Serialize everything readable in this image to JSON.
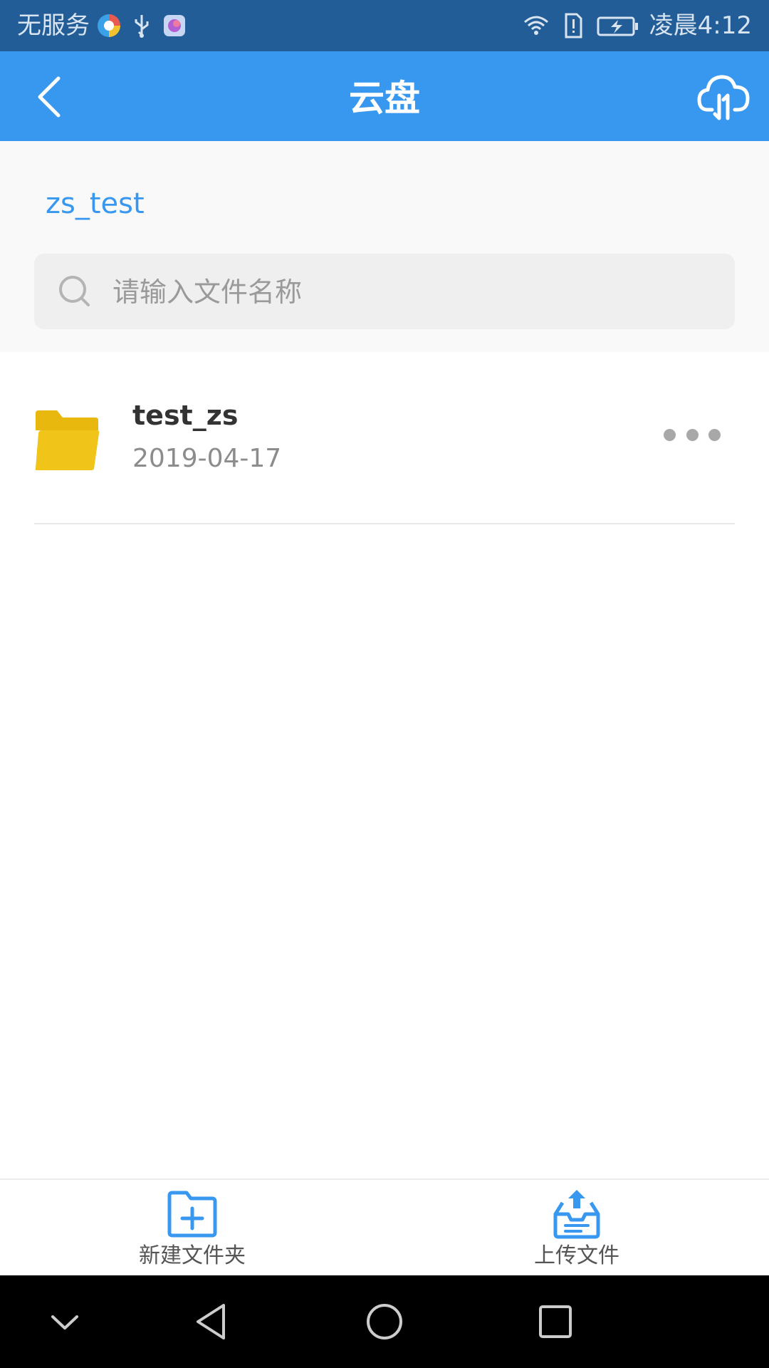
{
  "status_bar": {
    "carrier": "无服务",
    "time": "凌晨4:12"
  },
  "app_bar": {
    "title": "云盘",
    "back_icon": "back-arrow-icon",
    "cloud_icon": "cloud-transfer-icon"
  },
  "breadcrumb": {
    "current_folder": "zs_test"
  },
  "search": {
    "placeholder": "请输入文件名称",
    "value": ""
  },
  "files": [
    {
      "name": "test_zs",
      "date": "2019-04-17",
      "icon": "folder-icon"
    }
  ],
  "bottom_actions": {
    "new_folder_label": "新建文件夹",
    "upload_label": "上传文件"
  },
  "colors": {
    "primary": "#3898ef",
    "status_bar": "#235d97",
    "folder": "#f0c419"
  }
}
